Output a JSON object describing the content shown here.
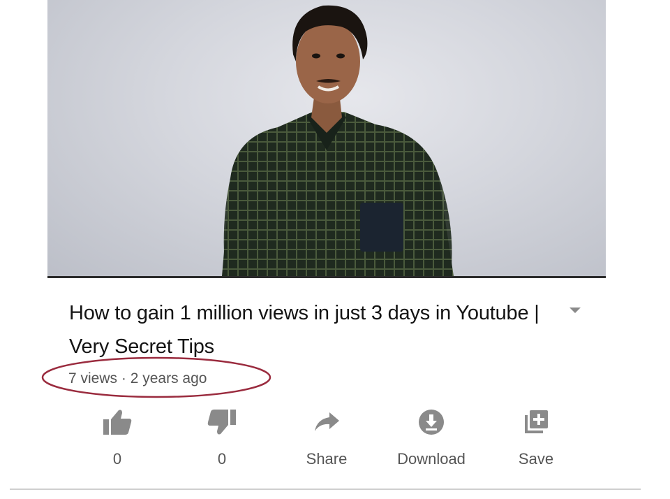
{
  "video": {
    "title": "How to gain 1 million views in just 3 days in Youtube | Very Secret Tips",
    "views": "7 views",
    "separator": "·",
    "age": "2 years ago"
  },
  "actions": {
    "like_count": "0",
    "dislike_count": "0",
    "share_label": "Share",
    "download_label": "Download",
    "save_label": "Save"
  },
  "icons": {
    "like": "thumbs-up-icon",
    "dislike": "thumbs-down-icon",
    "share": "share-arrow-icon",
    "download": "download-icon",
    "save": "add-to-playlist-icon",
    "menu": "caret-down-icon"
  },
  "colors": {
    "annotation_circle": "#9a2b3e",
    "icon_gray": "#8a8a8a",
    "text_secondary": "#555555"
  }
}
